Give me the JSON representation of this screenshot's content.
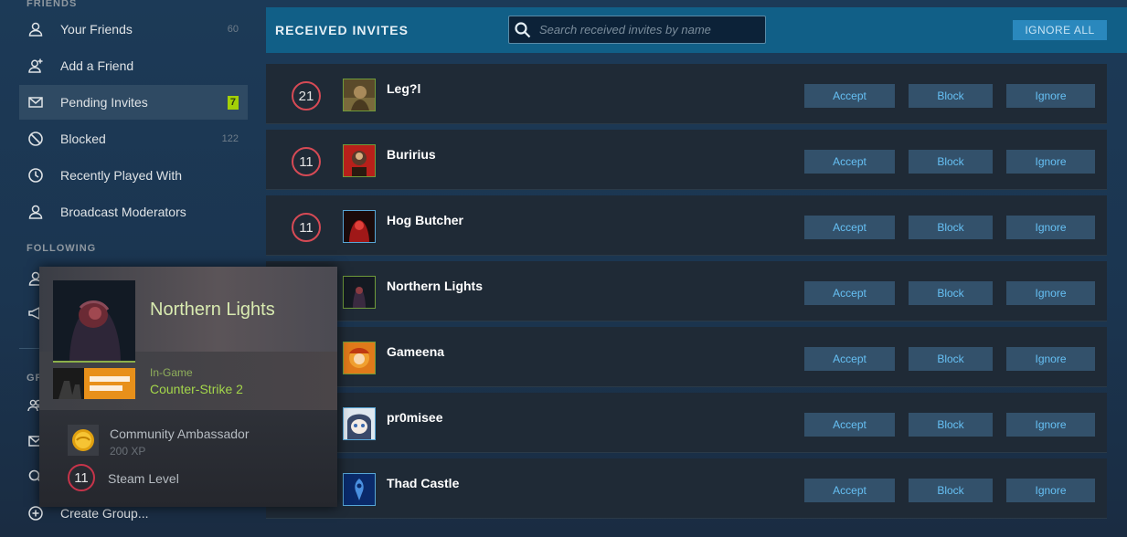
{
  "sidebar": {
    "friends_heading": "FRIENDS",
    "following_heading": "FOLLOWING",
    "groups_heading_partial": "GR",
    "items": [
      {
        "label": "Your Friends",
        "count": "60",
        "icon": "person-icon"
      },
      {
        "label": "Add a Friend",
        "icon": "add-person-icon"
      },
      {
        "label": "Pending Invites",
        "badge": "7",
        "icon": "envelope-icon"
      },
      {
        "label": "Blocked",
        "count": "122",
        "icon": "blocked-icon"
      },
      {
        "label": "Recently Played With",
        "icon": "clock-icon"
      },
      {
        "label": "Broadcast Moderators",
        "icon": "person-icon"
      }
    ],
    "create_group": {
      "label": "Create Group...",
      "icon": "plus-circle-icon"
    }
  },
  "header": {
    "title": "RECEIVED INVITES",
    "search_placeholder": "Search received invites by name",
    "ignore_all_label": "IGNORE ALL"
  },
  "buttons": {
    "accept": "Accept",
    "block": "Block",
    "ignore": "Ignore"
  },
  "invites": [
    {
      "level": "21",
      "name": "Leg?l"
    },
    {
      "level": "11",
      "name": "Buririus"
    },
    {
      "level": "11",
      "name": "Hog Butcher"
    },
    {
      "level": "",
      "name": "Northern Lights"
    },
    {
      "level": "",
      "name": "Gameena"
    },
    {
      "level": "",
      "name": "pr0misee"
    },
    {
      "level": "",
      "name": "Thad Castle"
    }
  ],
  "hover_card": {
    "name": "Northern Lights",
    "status_label": "In-Game",
    "game": "Counter-Strike 2",
    "badge_title": "Community Ambassador",
    "badge_xp": "200 XP",
    "level": "11",
    "level_label": "Steam Level"
  },
  "colors": {
    "accent": "#66c0f4",
    "header_bg": "#115f87",
    "pending_badge": "#a4d007",
    "level_ring": "#d64a55",
    "in_game": "#a4d64a"
  }
}
